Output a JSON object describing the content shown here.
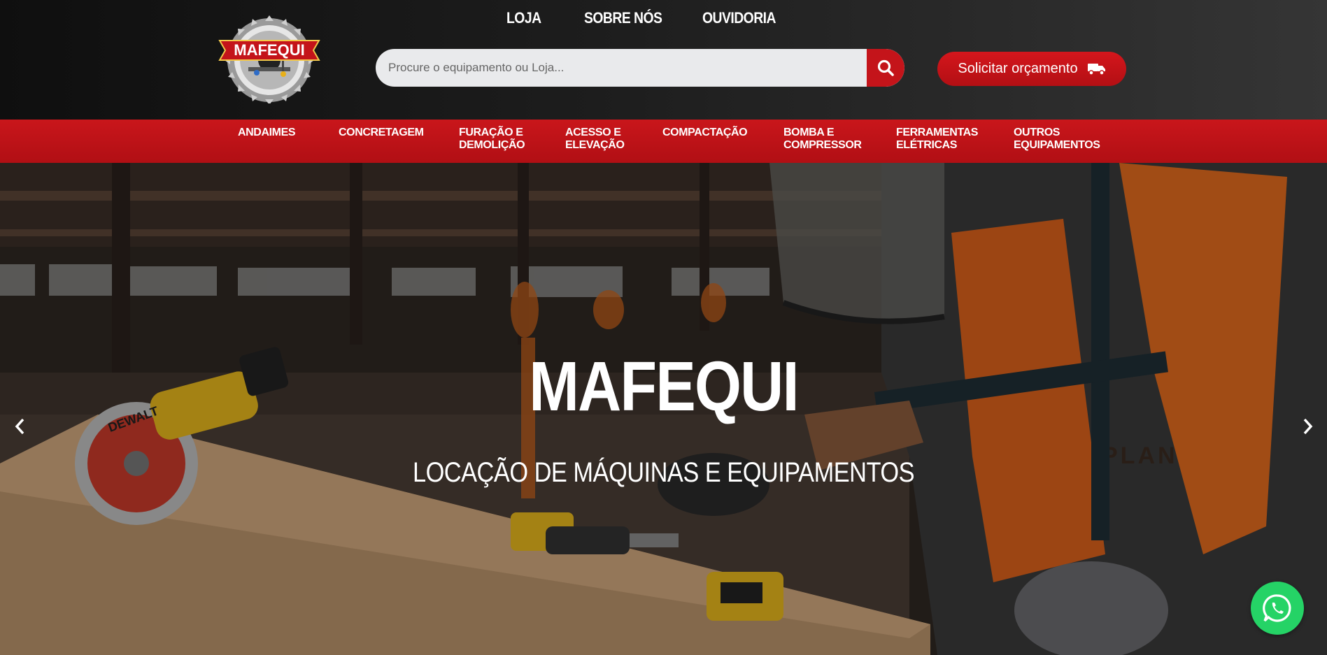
{
  "header": {
    "logo_text": "MAFEQUI",
    "nav": [
      {
        "label": "LOJA"
      },
      {
        "label": "SOBRE NÓS"
      },
      {
        "label": "OUVIDORIA"
      }
    ],
    "search": {
      "placeholder": "Procure o equipamento ou Loja...",
      "button_icon": "search-icon"
    },
    "quote_button": {
      "label": "Solicitar orçamento",
      "icon": "truck-icon"
    }
  },
  "categories": [
    {
      "label": "ANDAIMES"
    },
    {
      "label": "CONCRETAGEM"
    },
    {
      "label": "FURAÇÃO E\nDEMOLIÇÃO"
    },
    {
      "label": "ACESSO E\nELEVAÇÃO"
    },
    {
      "label": "COMPACTAÇÃO"
    },
    {
      "label": "BOMBA E\nCOMPRESSOR"
    },
    {
      "label": "FERRAMENTAS\nELÉTRICAS"
    },
    {
      "label": "OUTROS\nEQUIPAMENTOS"
    }
  ],
  "hero": {
    "title": "MAFEQUI",
    "subtitle": "LOCAÇÃO DE MÁQUINAS E EQUIPAMENTOS",
    "prev_icon": "chevron-left-icon",
    "next_icon": "chevron-right-icon",
    "saw_brand": "DEWALT",
    "vest_text": "PLAN"
  },
  "whatsapp": {
    "icon": "whatsapp-icon"
  },
  "colors": {
    "brand_red": "#c4141a",
    "header_dark": "#1d1d1d",
    "whatsapp_green": "#25d366"
  }
}
